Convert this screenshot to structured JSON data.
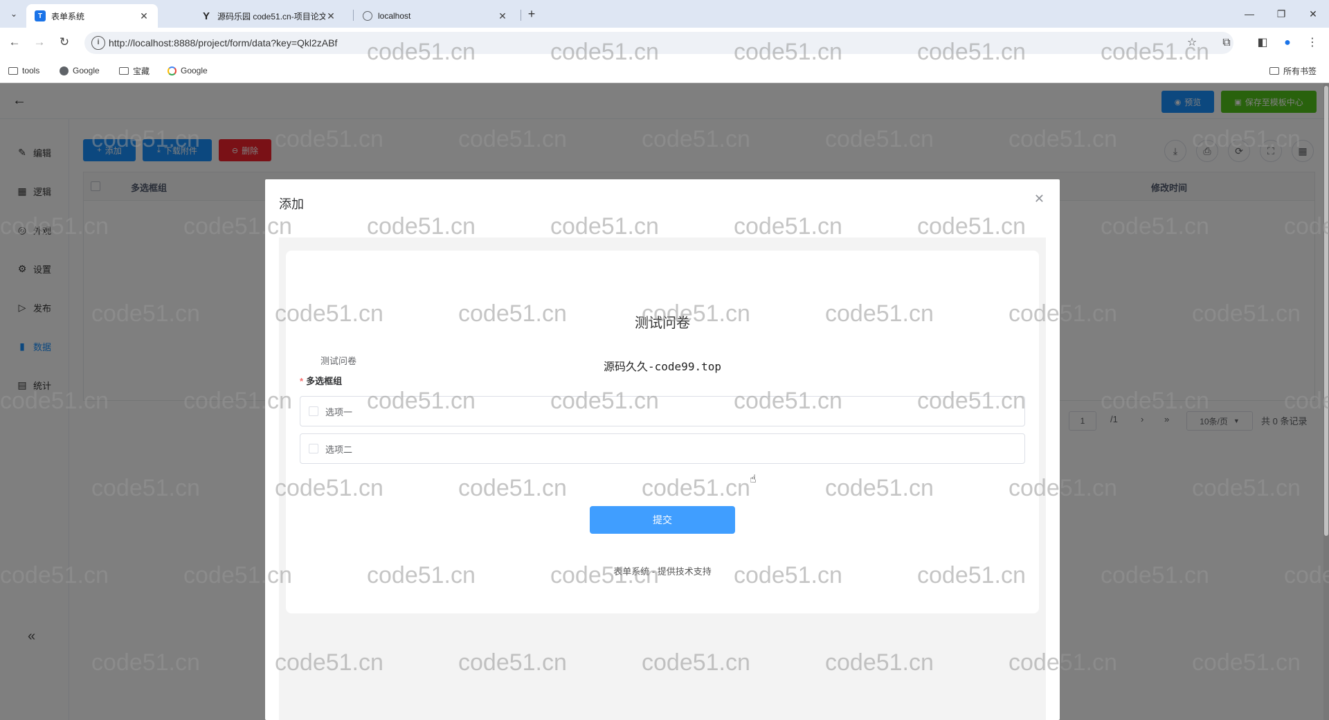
{
  "browser": {
    "tabs": [
      {
        "title": "表单系统",
        "favicon": "T",
        "favicon_color": "#1a73e8",
        "active": true
      },
      {
        "title": "源码乐园 code51.cn-项目论文",
        "favicon": "Y",
        "favicon_color": "#222222",
        "active": false
      },
      {
        "title": "localhost",
        "favicon": "globe",
        "favicon_color": "#5f6368",
        "active": false
      }
    ],
    "url": "http://localhost:8888/project/form/data?key=Qkl2zABf",
    "bookmarks": [
      {
        "label": "tools",
        "icon": "folder-icon"
      },
      {
        "label": "Google",
        "icon": "globe-icon"
      },
      {
        "label": "宝藏",
        "icon": "folder-icon"
      },
      {
        "label": "Google",
        "icon": "google-icon"
      }
    ],
    "all_bookmarks": "所有书签"
  },
  "header": {
    "preview_label": "预览",
    "save_template_label": "保存至模板中心"
  },
  "sidebar": {
    "items": [
      {
        "label": "编辑",
        "icon": "edit-icon"
      },
      {
        "label": "逻辑",
        "icon": "grid-icon"
      },
      {
        "label": "外观",
        "icon": "eye-icon"
      },
      {
        "label": "设置",
        "icon": "gear-icon"
      },
      {
        "label": "发布",
        "icon": "play-icon"
      },
      {
        "label": "数据",
        "icon": "bar-chart-icon",
        "active": true
      },
      {
        "label": "统计",
        "icon": "stats-icon"
      }
    ]
  },
  "toolbar": {
    "add_label": "添加",
    "download_label": "下载附件",
    "delete_label": "删除"
  },
  "grid": {
    "columns": [
      "多选框组",
      "修改时间"
    ]
  },
  "pager": {
    "page": "1",
    "total_pages": "/1",
    "page_size": "10条/页",
    "total": "共 0 条记录"
  },
  "dialog": {
    "title": "添加",
    "form": {
      "title": "测试问卷",
      "description_left": "测试问卷",
      "description_center": "源码久久-code99.top",
      "field_label": "多选框组",
      "options": [
        "选项一",
        "选项二"
      ],
      "submit_label": "提交",
      "footer": "表单系统 - 提供技术支持"
    }
  },
  "watermark": "code51.cn",
  "colors": {
    "primary": "#1890ff",
    "success": "#52c41a",
    "danger": "#f5222d",
    "submit": "#409eff"
  }
}
